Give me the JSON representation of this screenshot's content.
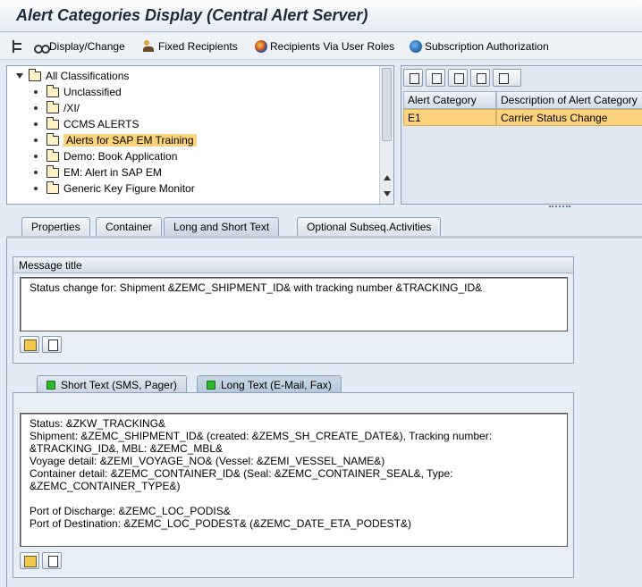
{
  "window": {
    "title": "Alert Categories Display (Central Alert Server)"
  },
  "toolbar": {
    "items": [
      {
        "label": "",
        "icon": "tree-icon"
      },
      {
        "label": "Display/Change",
        "icon": "glasses-icon"
      },
      {
        "label": "Fixed Recipients",
        "icon": "people-icon"
      },
      {
        "label": "Recipients Via User Roles",
        "icon": "globe-icon"
      },
      {
        "label": "Subscription Authorization",
        "icon": "globe-icon"
      }
    ]
  },
  "tree": {
    "root": "All Classifications",
    "items": [
      {
        "label": "Unclassified"
      },
      {
        "label": "/XI/"
      },
      {
        "label": "CCMS ALERTS"
      },
      {
        "label": "Alerts for SAP EM Training",
        "selected": true
      },
      {
        "label": "Demo: Book Application"
      },
      {
        "label": "EM: Alert in SAP EM"
      },
      {
        "label": "Generic Key Figure Monitor"
      }
    ]
  },
  "grid": {
    "columns": [
      "Alert Category",
      "Description of Alert Category"
    ],
    "rows": [
      {
        "category": "E1",
        "description": "Carrier Status Change"
      }
    ]
  },
  "tabs": {
    "items": [
      "Properties",
      "Container",
      "Long and Short Text",
      "Optional Subseq.Activities"
    ],
    "active": "Long and Short Text"
  },
  "message_title": {
    "group_label": "Message title",
    "text": "Status change for: Shipment &ZEMC_SHIPMENT_ID& with tracking number &TRACKING_ID&"
  },
  "text_tabs": {
    "items": [
      "Short Text (SMS, Pager)",
      "Long Text (E-Mail, Fax)"
    ],
    "active": "Long Text (E-Mail, Fax)"
  },
  "long_text": {
    "content": "Status: &ZKW_TRACKING&\nShipment: &ZEMC_SHIPMENT_ID& (created: &ZEMS_SH_CREATE_DATE&), Tracking number:\n&TRACKING_ID&, MBL: &ZEMC_MBL&\nVoyage detail: &ZEMI_VOYAGE_NO& (Vessel: &ZEMI_VESSEL_NAME&)\nContainer detail: &ZEMC_CONTAINER_ID& (Seal: &ZEMC_CONTAINER_SEAL&, Type:\n&ZEMC_CONTAINER_TYPE&)\n\nPort of Discharge: &ZEMC_LOC_PODIS&\nPort of Destination: &ZEMC_LOC_PODEST& (&ZEMC_DATE_ETA_PODEST&)"
  },
  "colors": {
    "selection": "#fbd37c",
    "status_led": "#2eb82e"
  }
}
